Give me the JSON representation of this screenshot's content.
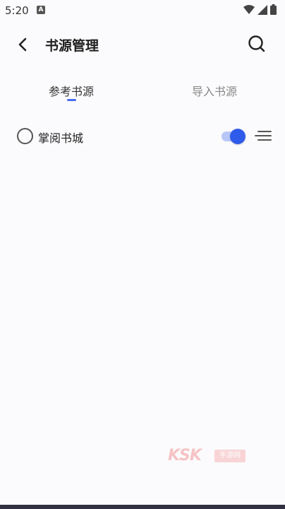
{
  "status_bar": {
    "time": "5:20",
    "notification_icon": "a-icon",
    "icons": [
      "wifi-icon",
      "signal-icon",
      "battery-icon"
    ]
  },
  "header": {
    "title": "书源管理",
    "back_icon": "chevron-left-icon",
    "search_icon": "search-icon"
  },
  "tabs": [
    {
      "label": "参考书源",
      "active": true
    },
    {
      "label": "导入书源",
      "active": false
    }
  ],
  "sources": [
    {
      "name": "掌阅书城",
      "selected": false,
      "enabled": true
    }
  ],
  "colors": {
    "accent": "#2f5bea",
    "accent_light": "#b8c7f7",
    "tab_indicator": "#4a6cf0",
    "background": "#fbfbfd",
    "bottom_bar": "#2f3142"
  },
  "watermark": {
    "text": "KSK",
    "sub": "手游网"
  }
}
